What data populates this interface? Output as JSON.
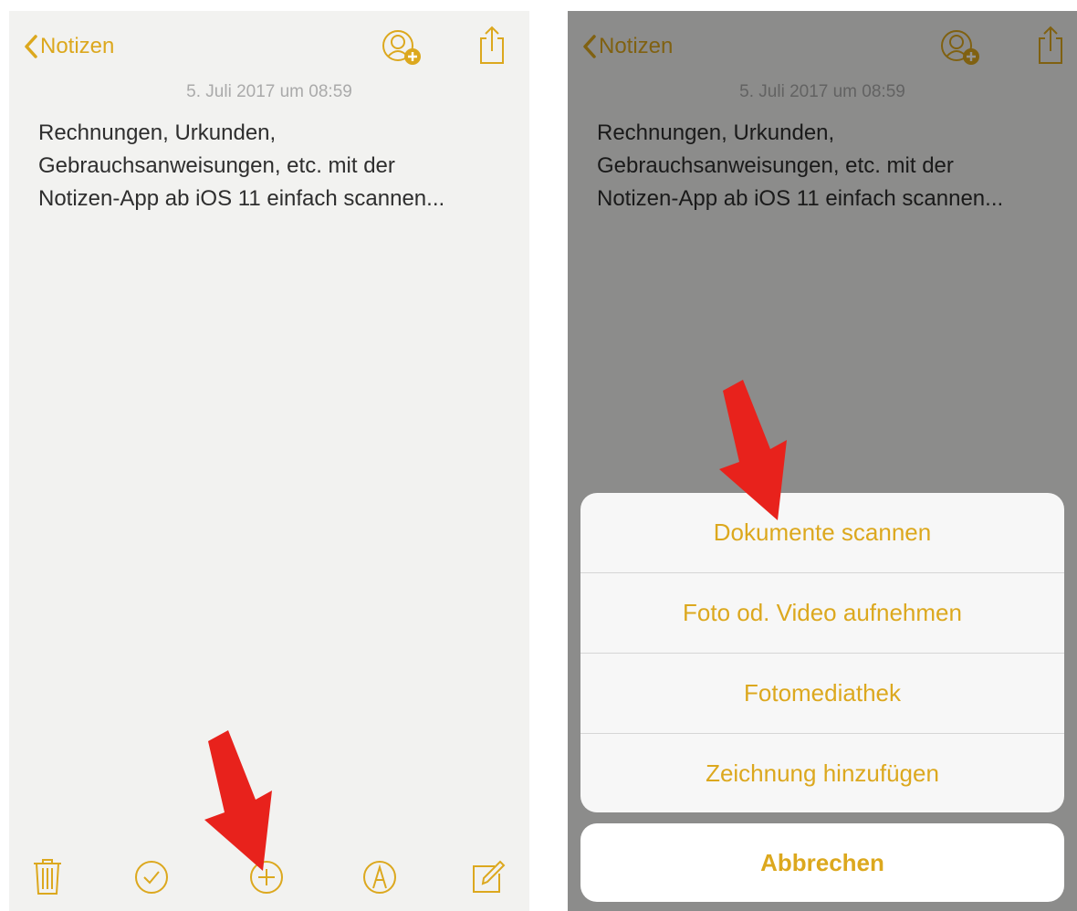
{
  "left": {
    "nav": {
      "back_label": "Notizen"
    },
    "note": {
      "date": "5. Juli 2017 um 08:59",
      "lines": [
        "Rechnungen, Urkunden,",
        "Gebrauchsanweisungen, etc. mit der",
        "Notizen-App ab iOS 11 einfach scannen..."
      ]
    },
    "toolbar": [
      "trash-icon",
      "checklist-icon",
      "add-icon",
      "markup-icon",
      "compose-icon"
    ]
  },
  "right": {
    "nav": {
      "back_label": "Notizen"
    },
    "note": {
      "date": "5. Juli 2017 um 08:59",
      "lines": [
        "Rechnungen, Urkunden,",
        "Gebrauchsanweisungen, etc. mit der",
        "Notizen-App ab iOS 11 einfach scannen..."
      ]
    },
    "action_sheet": {
      "items": [
        "Dokumente scannen",
        "Foto od. Video aufnehmen",
        "Fotomediathek",
        "Zeichnung hinzufügen"
      ],
      "cancel": "Abbrechen"
    }
  },
  "colors": {
    "accent": "#dca81e",
    "arrow": "#e8221c",
    "paper": "#f2f2f0",
    "text": "#2e2e2e",
    "date": "#aaaaaa"
  }
}
